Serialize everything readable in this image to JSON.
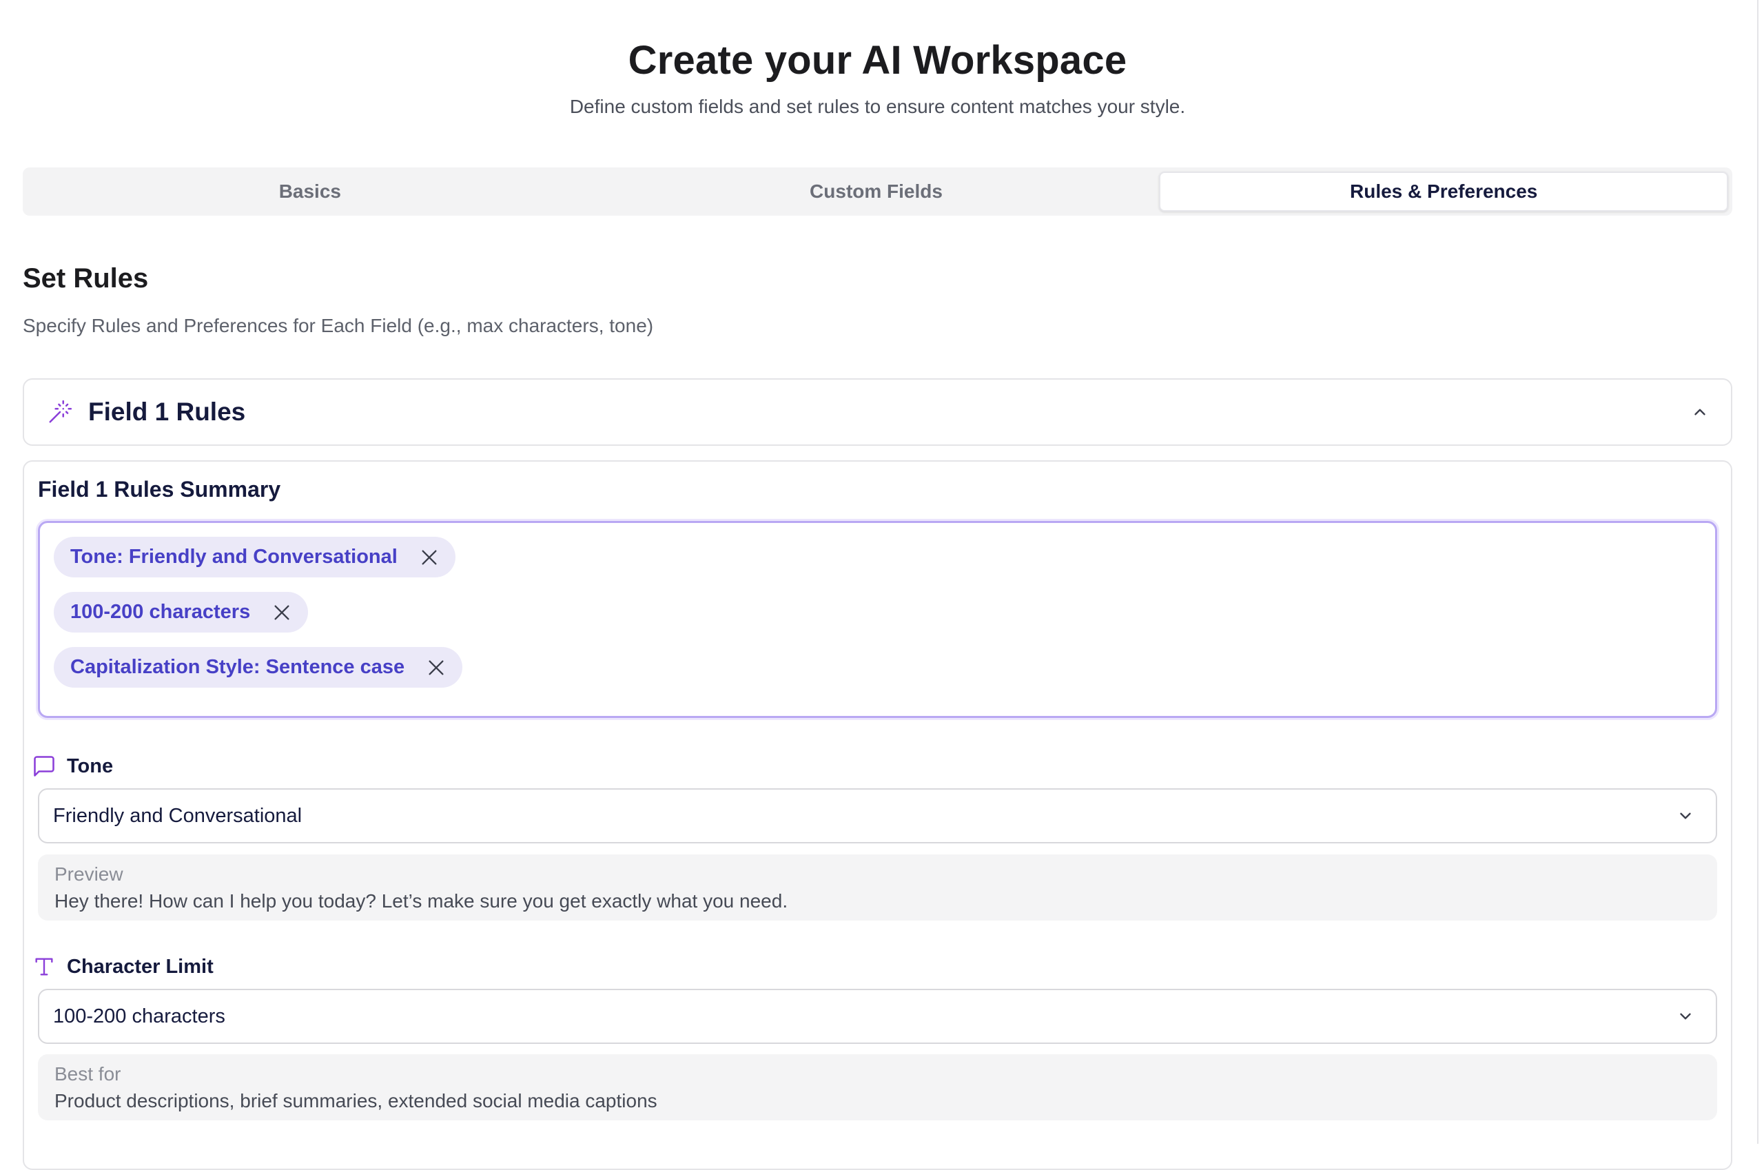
{
  "header": {
    "title": "Create your AI Workspace",
    "subtitle": "Define custom fields and set rules to ensure content matches your style."
  },
  "tabs": [
    {
      "label": "Basics",
      "active": false
    },
    {
      "label": "Custom Fields",
      "active": false
    },
    {
      "label": "Rules & Preferences",
      "active": true
    }
  ],
  "section": {
    "title": "Set Rules",
    "description": "Specify Rules and Preferences for Each Field (e.g., max characters, tone)"
  },
  "accordion": {
    "title": "Field 1 Rules",
    "icon": "magic-wand-icon",
    "expanded": true
  },
  "summary": {
    "label": "Field 1 Rules Summary",
    "chips": [
      {
        "label": "Tone: Friendly and Conversational"
      },
      {
        "label": "100-200 characters"
      },
      {
        "label": "Capitalization Style: Sentence case"
      }
    ]
  },
  "tone": {
    "label": "Tone",
    "icon": "message-square-icon",
    "value": "Friendly and Conversational",
    "preview_heading": "Preview",
    "preview_text": "Hey there! How can I help you today? Let’s make sure you get exactly what you need."
  },
  "character_limit": {
    "label": "Character Limit",
    "icon": "type-icon",
    "value": "100-200 characters",
    "info_heading": "Best for",
    "info_text": "Product descriptions, brief summaries, extended social media captions"
  },
  "colors": {
    "accent_purple": "#8b3fd9",
    "chip_background": "#ebe9f8",
    "chip_text": "#4740c6",
    "focus_border": "#b9a8f3"
  }
}
